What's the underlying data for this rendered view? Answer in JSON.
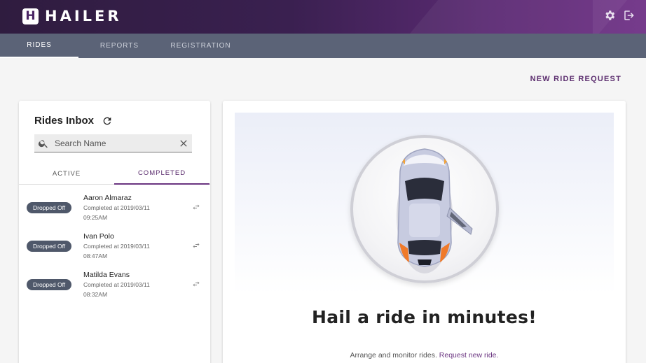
{
  "app": {
    "brand": "HAILER",
    "logo_letter": "H"
  },
  "header": {
    "icons": [
      "gear-icon",
      "logout-icon"
    ]
  },
  "nav": {
    "tabs": [
      {
        "label": "RIDES",
        "active": true
      },
      {
        "label": "REPORTS",
        "active": false
      },
      {
        "label": "REGISTRATION",
        "active": false
      }
    ]
  },
  "actions": {
    "new_ride_label": "NEW RIDE REQUEST"
  },
  "inbox": {
    "title": "Rides Inbox",
    "search_placeholder": "Search Name",
    "tabs": [
      {
        "label": "ACTIVE",
        "active": false
      },
      {
        "label": "COMPLETED",
        "active": true
      }
    ],
    "rides": [
      {
        "status": "Dropped Off",
        "name": "Aaron Almaraz",
        "completed": "Completed at 2019/03/11",
        "time": "09:25AM"
      },
      {
        "status": "Dropped Off",
        "name": "Ivan Polo",
        "completed": "Completed at 2019/03/11",
        "time": "08:47AM"
      },
      {
        "status": "Dropped Off",
        "name": "Matilda Evans",
        "completed": "Completed at 2019/03/11",
        "time": "08:32AM"
      }
    ]
  },
  "hero": {
    "headline": "Hail a ride in minutes!",
    "subtext": "Arrange and monitor rides.",
    "link_text": "Request new ride."
  },
  "colors": {
    "brand_purple": "#5b2d6e",
    "nav_bg": "#5b6377",
    "badge_bg": "#4f586a"
  }
}
